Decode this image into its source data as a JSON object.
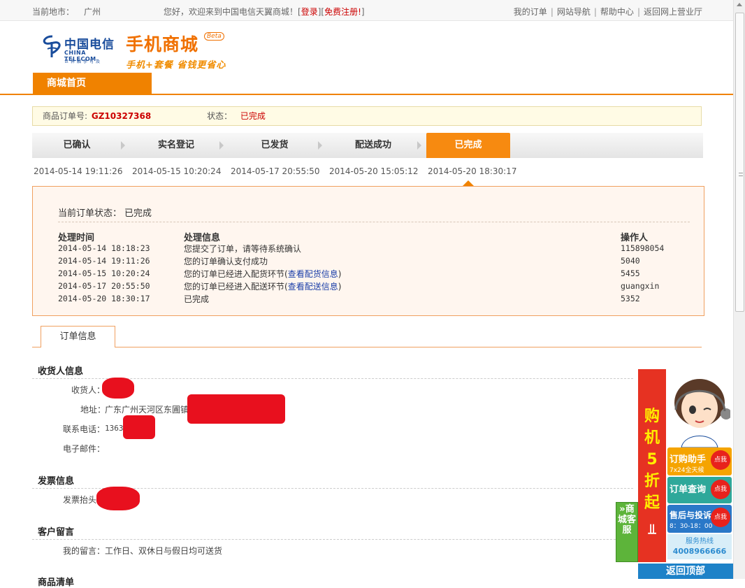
{
  "topbar": {
    "city_label": "当前地市：",
    "city": "广州",
    "welcome": "您好，欢迎来到中国电信天翼商城！[",
    "login": "登录",
    "mid": "][",
    "register": "免费注册!",
    "end": "]",
    "links": [
      "我的订单",
      "网站导航",
      "帮助中心",
      "返回网上营业厅"
    ]
  },
  "header": {
    "logo_cn": "中国电信",
    "logo_en": "CHINA TELECOM",
    "logo_slogan": "世界触手可及",
    "mall_title": "手机商城",
    "beta": "Beta",
    "mall_slogan": "手机+套餐  省钱更省心",
    "nav_home": "商城首页"
  },
  "order": {
    "no_label": "商品订单号:",
    "no": "GZ10327368",
    "status_label": "状态：",
    "status": "已完成"
  },
  "steps": [
    {
      "label": "已确认",
      "time": "2014-05-14 19:11:26"
    },
    {
      "label": "实名登记",
      "time": "2014-05-15 10:20:24"
    },
    {
      "label": "已发货",
      "time": "2014-05-17 20:55:50"
    },
    {
      "label": "配送成功",
      "time": "2014-05-20 15:05:12"
    },
    {
      "label": "已完成",
      "time": "2014-05-20 18:30:17"
    }
  ],
  "status_box": {
    "current_label": "当前订单状态：",
    "current": "已完成",
    "col_time": "处理时间",
    "col_info": "处理信息",
    "col_op": "操作人",
    "rows": [
      {
        "time": "2014-05-14 18:18:23",
        "info": "您提交了订单，请等待系统确认",
        "op": "115898054"
      },
      {
        "time": "2014-05-14 19:11:26",
        "info": "您的订单确认支付成功",
        "op": "5040"
      },
      {
        "time": "2014-05-15 10:20:24",
        "info": "您的订单已经进入配货环节(",
        "link": "查看配货信息",
        "tail": ")",
        "op": "5455"
      },
      {
        "time": "2014-05-17 20:55:50",
        "info": "您的订单已经进入配送环节(",
        "link": "查看配送信息",
        "tail": ")",
        "op": "guangxin"
      },
      {
        "time": "2014-05-20 18:30:17",
        "info": "已完成",
        "op": "5352"
      }
    ]
  },
  "info": {
    "tab": "订单信息",
    "receiver_title": "收货人信息",
    "receiver_label": "收货人：",
    "address_label": "地址：",
    "address_prefix": "广东广州天河区东圃镇",
    "phone_label": "联系电话：",
    "phone_prefix": "13632469",
    "email_label": "电子邮件：",
    "invoice_title": "发票信息",
    "invoice_label": "发票抬头：",
    "msg_title": "客户留言",
    "msg_label": "我的留言：",
    "msg": "工作日、双休日与假日均可送货",
    "goods_title": "商品清单"
  },
  "side": {
    "kefu": "»商城客服",
    "promo": [
      "购",
      "机",
      "5",
      "折",
      "起"
    ],
    "btn1": "订购助手",
    "btn1_sub": "7x24全天候",
    "btn2": "订单查询",
    "btn3": "售后与投诉",
    "btn3_sub": "8：30-18：00",
    "click": "点我",
    "hotline_label": "服务热线",
    "hotline": "4008966666",
    "top": "返回顶部"
  },
  "colors": {
    "orange": "#f08200",
    "red": "#cc0000",
    "link": "#1a3ea8"
  }
}
